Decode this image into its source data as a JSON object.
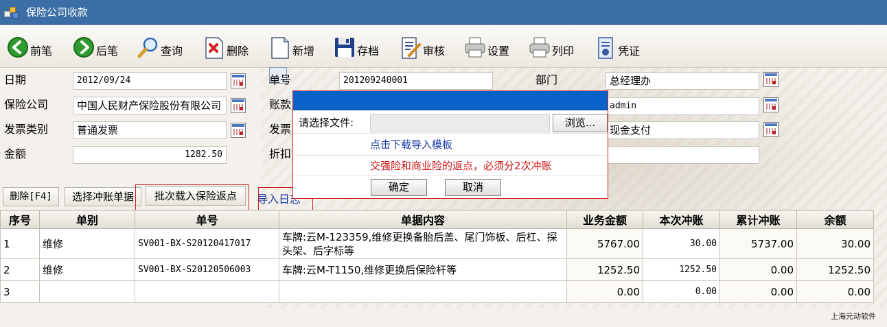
{
  "window": {
    "title": "保险公司收款"
  },
  "toolbar": {
    "prev": "前笔",
    "next": "后笔",
    "query": "查询",
    "delete": "删除",
    "add": "新增",
    "save": "存档",
    "review": "审核",
    "settings": "设置",
    "print": "列印",
    "voucher": "凭证"
  },
  "form": {
    "date_label": "日期",
    "date_value": "2012/09/24",
    "doc_no_label": "单号",
    "doc_no_value": "201209240001",
    "dept_label": "部门",
    "dept_value": "总经理办",
    "insurer_label": "保险公司",
    "insurer_value": "中国人民财产保险股份有限公司",
    "account_label": "账款",
    "operator_value": "admin",
    "invoice_type_label": "发票类别",
    "invoice_type_value": "普通发票",
    "invoice_label": "发票",
    "payment_value": "现金支付",
    "amount_label": "金额",
    "amount_value": "1282.50",
    "discount_label": "折扣"
  },
  "actions": {
    "delete_f4": "删除[F4]",
    "select_offset": "选择冲账单据",
    "batch_load": "批次载入保险返点",
    "import_log": "导入日志"
  },
  "grid": {
    "columns": [
      "序号",
      "单别",
      "单号",
      "单据内容",
      "业务金额",
      "本次冲账",
      "累计冲账",
      "余额"
    ],
    "rows": [
      {
        "seq": "1",
        "type": "维修",
        "no": "SV001-BX-S20120417017",
        "content": "车牌:云M-123359,维修更换备胎后盖、尾门饰板、后杠、探头架、后字标等",
        "amount": "5767.00",
        "this_offset": "30.00",
        "total_offset": "5737.00",
        "balance": "30.00"
      },
      {
        "seq": "2",
        "type": "维修",
        "no": "SV001-BX-S20120506003",
        "content": "车牌:云M-T1150,维修更换后保险杆等",
        "amount": "1252.50",
        "this_offset": "1252.50",
        "total_offset": "0.00",
        "balance": "1252.50"
      },
      {
        "seq": "3",
        "type": "",
        "no": "",
        "content": "",
        "amount": "0.00",
        "this_offset": "0.00",
        "total_offset": "0.00",
        "balance": "0.00"
      }
    ]
  },
  "dialog": {
    "file_label": "请选择文件:",
    "browse": "浏览...",
    "template_link": "点击下载导入模板",
    "warning": "交强险和商业险的返点，必须分2次冲账",
    "ok": "确定",
    "cancel": "取消"
  },
  "footer": {
    "brand": "上海元动软件"
  },
  "colors": {
    "titlebar": "#3a6ea5",
    "dialog_header": "#0a62c8",
    "warning": "#d01010",
    "link": "#1a3aa8"
  }
}
